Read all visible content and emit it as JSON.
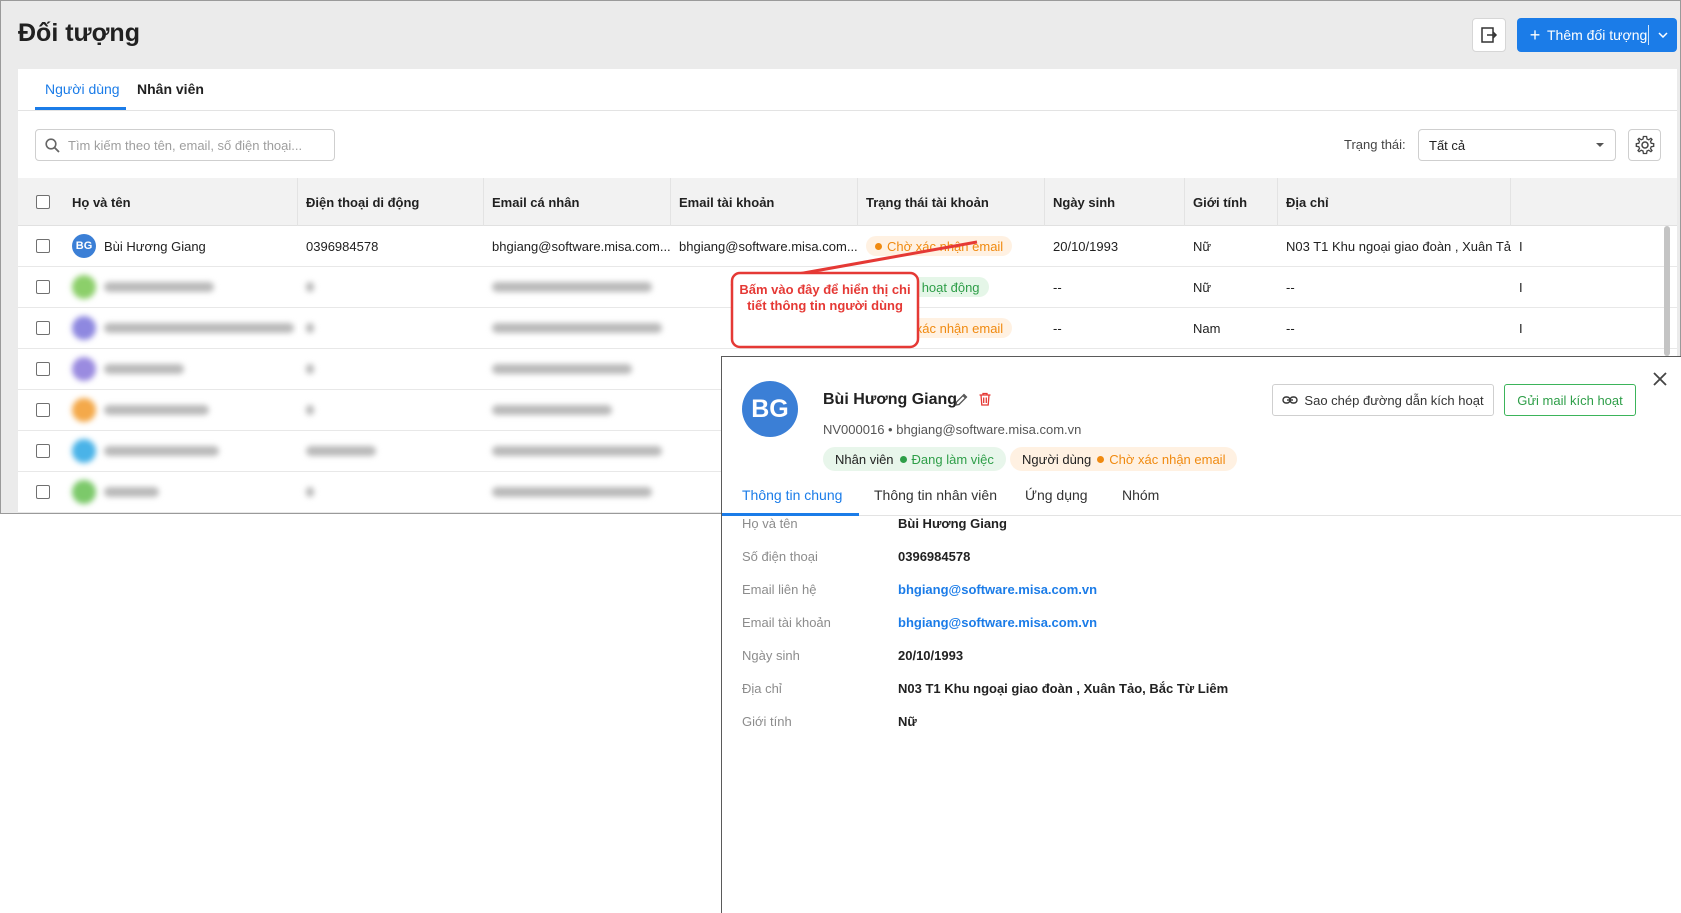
{
  "page": {
    "title": "Đối tượng",
    "add_button": "Thêm đối tượng"
  },
  "tabs": [
    {
      "label": "Người dùng"
    },
    {
      "label": "Nhân viên"
    }
  ],
  "search": {
    "placeholder": "Tìm kiếm theo tên, email, số điện thoại..."
  },
  "filter": {
    "label": "Trạng thái:",
    "value": "Tất cả"
  },
  "table": {
    "columns": [
      "Họ và tên",
      "Điện thoại di động",
      "Email cá nhân",
      "Email tài khoản",
      "Trạng thái tài khoản",
      "Ngày sinh",
      "Giới tính",
      "Địa chỉ"
    ],
    "rows": [
      {
        "initials": "BG",
        "avatar_color": "#3b7fd6",
        "name": "Bùi Hương Giang",
        "phone": "0396984578",
        "email_personal": "bhgiang@software.misa.com....",
        "email_account": "bhgiang@software.misa.com....",
        "status": "Chờ xác nhận email",
        "status_type": "pending",
        "dob": "20/10/1993",
        "gender": "Nữ",
        "address": "N03 T1 Khu ngoại giao đoàn , Xuân Tả..."
      },
      {
        "avatar_color": "#8ccf6a",
        "status": "Đang hoạt động",
        "status_type": "active",
        "dob": "--",
        "gender": "Nữ",
        "address": "--",
        "blurred": true
      },
      {
        "avatar_color": "#8e88e0",
        "status": "Chờ xác nhận email",
        "status_type": "pending",
        "dob": "--",
        "gender": "Nam",
        "address": "--",
        "blurred": true
      },
      {
        "avatar_color": "#9a8be0",
        "blurred": true
      },
      {
        "avatar_color": "#f4a94a",
        "blurred": true
      },
      {
        "avatar_color": "#4ab3e8",
        "blurred": true
      },
      {
        "avatar_color": "#7cc96a",
        "blurred": true
      }
    ]
  },
  "callout": {
    "text": "Bấm vào đây để hiển thị chi tiết thông tin người dùng"
  },
  "detail": {
    "initials": "BG",
    "name": "Bùi Hương Giang",
    "subtitle": "NV000016 • bhgiang@software.misa.com.vn",
    "employee_label": "Nhân viên",
    "employee_status": "Đang làm việc",
    "user_label": "Người dùng",
    "user_status": "Chờ xác nhận email",
    "copy_button": "Sao chép đường dẫn kích hoạt",
    "mail_button": "Gửi mail kích hoạt",
    "tabs": [
      "Thông tin chung",
      "Thông tin nhân viên",
      "Ứng dụng",
      "Nhóm"
    ],
    "fields": [
      {
        "label": "Họ và tên",
        "value": "Bùi Hương Giang"
      },
      {
        "label": "Số điện thoại",
        "value": "0396984578"
      },
      {
        "label": "Email liên hệ",
        "value": "bhgiang@software.misa.com.vn"
      },
      {
        "label": "Email tài khoản",
        "value": "bhgiang@software.misa.com.vn"
      },
      {
        "label": "Ngày sinh",
        "value": "20/10/1993"
      },
      {
        "label": "Địa chỉ",
        "value": "N03 T1 Khu ngoại giao đoàn , Xuân Tảo, Bắc Từ Liêm"
      },
      {
        "label": "Giới tính",
        "value": "Nữ"
      }
    ]
  },
  "colors": {
    "primary": "#1b7ce8",
    "success": "#2e9e48",
    "warning": "#f08a10",
    "callout": "#e53935"
  }
}
